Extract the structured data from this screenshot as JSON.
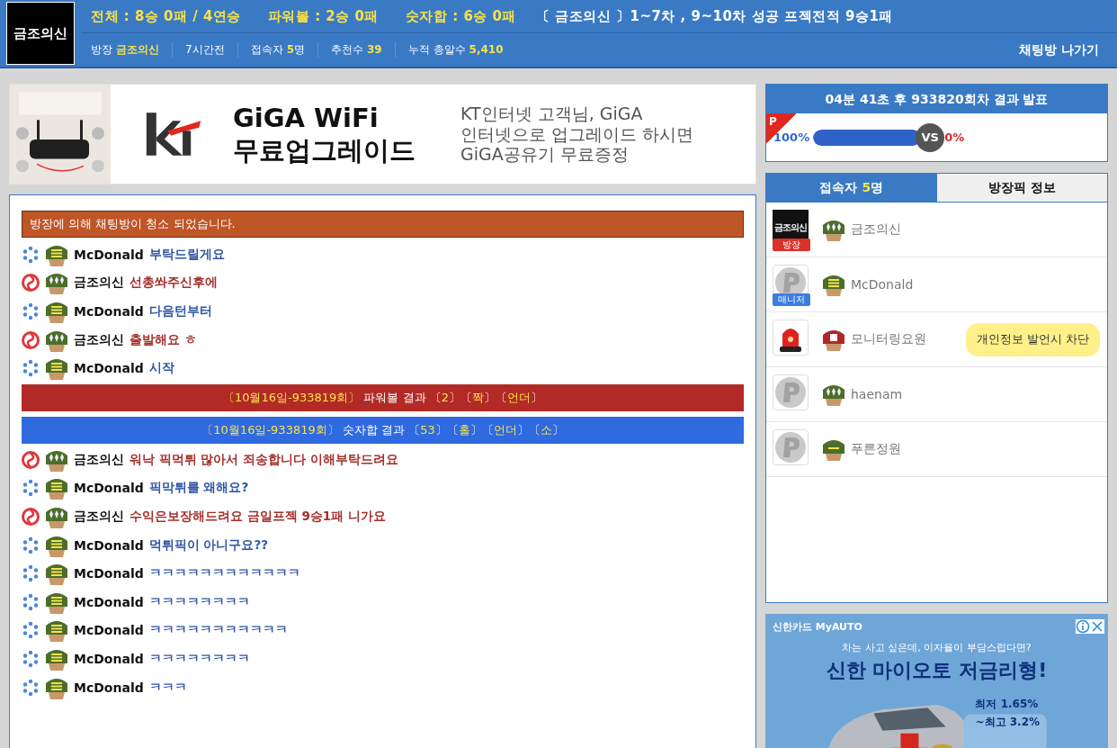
{
  "header": {
    "logo": "금조의신",
    "records": [
      {
        "text": "전체 : 8승 0패 / 4연승",
        "highlight": true
      },
      {
        "text": "파워볼 : 2승 0패",
        "highlight": true
      },
      {
        "text": "숫자합 : 6승 0패",
        "highlight": true
      },
      {
        "text": "〔 금조의신 〕1~7차 , 9~10차 성공 프젝전적 9승1패",
        "highlight": false
      }
    ],
    "info": [
      {
        "label": "방장",
        "value": "금조의신"
      },
      {
        "label": "7시간전"
      },
      {
        "label": "접속자",
        "value": "5",
        "suffix": "명"
      },
      {
        "label": "추천수",
        "value": "39"
      },
      {
        "label": "누적 총알수",
        "value": "5,410"
      }
    ],
    "exit_button": "채팅방 나가기"
  },
  "banner_ad": {
    "title_lines": [
      "GiGA WiFi",
      "무료업그레이드"
    ],
    "body_lines": [
      "KT인터넷 고객님, GiGA",
      "인터넷으로 업그레이드 하시면",
      "GiGA공유기 무료증정"
    ]
  },
  "chat": [
    {
      "kind": "notice",
      "text": "방장에 의해 채팅방이 청소 되었습니다."
    },
    {
      "kind": "message",
      "badge": {
        "kind": "dots"
      },
      "cap": {
        "kind": "bars"
      },
      "name": "McDonald",
      "text": "부탁드릴게요",
      "color": "#2f55a4"
    },
    {
      "kind": "message",
      "badge": {
        "kind": "swirl"
      },
      "cap": {
        "kind": "diamonds"
      },
      "name": "금조의신",
      "text": "선총쏴주신후에",
      "color": "#a3302c"
    },
    {
      "kind": "message",
      "badge": {
        "kind": "dots"
      },
      "cap": {
        "kind": "bars"
      },
      "name": "McDonald",
      "text": "다음턴부터",
      "color": "#2f55a4"
    },
    {
      "kind": "message",
      "badge": {
        "kind": "swirl"
      },
      "cap": {
        "kind": "diamonds"
      },
      "name": "금조의신",
      "text": "출발해요 ㅎ",
      "color": "#a3302c"
    },
    {
      "kind": "message",
      "badge": {
        "kind": "dots"
      },
      "cap": {
        "kind": "bars"
      },
      "name": "McDonald",
      "text": "시작",
      "color": "#2f55a4"
    },
    {
      "kind": "result",
      "color": "#b22a26",
      "parts": [
        {
          "text": "〔10월16일-933819회〕",
          "highlight": true
        },
        {
          "text": " 파워볼 결과 〔",
          "highlight": false
        },
        {
          "text": "2",
          "highlight": true
        },
        {
          "text": "〕〔",
          "highlight": false
        },
        {
          "text": "짝",
          "highlight": true
        },
        {
          "text": "〕〔",
          "highlight": false
        },
        {
          "text": "언더",
          "highlight": true
        },
        {
          "text": "〕",
          "highlight": false
        }
      ]
    },
    {
      "kind": "result",
      "color": "#2f6ae0",
      "parts": [
        {
          "text": "〔10월16일-933819회〕",
          "highlight": true
        },
        {
          "text": " 숫자합 결과 〔",
          "highlight": false
        },
        {
          "text": "53",
          "highlight": true
        },
        {
          "text": "〕〔",
          "highlight": false
        },
        {
          "text": "홀",
          "highlight": true
        },
        {
          "text": "〕〔",
          "highlight": false
        },
        {
          "text": "언더",
          "highlight": true
        },
        {
          "text": "〕〔",
          "highlight": false
        },
        {
          "text": "소",
          "highlight": true
        },
        {
          "text": "〕",
          "highlight": false
        }
      ]
    },
    {
      "kind": "message",
      "badge": {
        "kind": "swirl"
      },
      "cap": {
        "kind": "diamonds"
      },
      "name": "금조의신",
      "text": "워낙 픽먹튀 많아서 죄송합니다 이해부탁드려요",
      "color": "#a3302c"
    },
    {
      "kind": "message",
      "badge": {
        "kind": "dots"
      },
      "cap": {
        "kind": "bars"
      },
      "name": "McDonald",
      "text": "픽막튀를 왜해요?",
      "color": "#2f55a4"
    },
    {
      "kind": "message",
      "badge": {
        "kind": "swirl"
      },
      "cap": {
        "kind": "diamonds"
      },
      "name": "금조의신",
      "text": "수익은보장해드려요 금일프젝 9승1패 니가요",
      "color": "#a3302c"
    },
    {
      "kind": "message",
      "badge": {
        "kind": "dots"
      },
      "cap": {
        "kind": "bars"
      },
      "name": "McDonald",
      "text": "먹튀픽이 아니구요??",
      "color": "#2f55a4"
    },
    {
      "kind": "message",
      "badge": {
        "kind": "dots"
      },
      "cap": {
        "kind": "bars"
      },
      "name": "McDonald",
      "text": "ㅋㅋㅋㅋㅋㅋㅋㅋㅋㅋㅋㅋ",
      "color": "#2f55a4"
    },
    {
      "kind": "message",
      "badge": {
        "kind": "dots"
      },
      "cap": {
        "kind": "bars"
      },
      "name": "McDonald",
      "text": "ㅋㅋㅋㅋㅋㅋㅋㅋ",
      "color": "#2f55a4"
    },
    {
      "kind": "message",
      "badge": {
        "kind": "dots"
      },
      "cap": {
        "kind": "bars"
      },
      "name": "McDonald",
      "text": "ㅋㅋㅋㅋㅋㅋㅋㅋㅋㅋㅋ",
      "color": "#2f55a4"
    },
    {
      "kind": "message",
      "badge": {
        "kind": "dots"
      },
      "cap": {
        "kind": "bars"
      },
      "name": "McDonald",
      "text": "ㅋㅋㅋㅋㅋㅋㅋㅋ",
      "color": "#2f55a4"
    },
    {
      "kind": "message",
      "badge": {
        "kind": "dots"
      },
      "cap": {
        "kind": "bars"
      },
      "name": "McDonald",
      "text": "ㅋㅋㅋ",
      "color": "#2f55a4"
    }
  ],
  "countdown": {
    "title": "04분 41초 후 933820회차 결과 발표",
    "corner": "P",
    "left_percent": "100%",
    "right_percent": "0%",
    "vs": "VS",
    "level": 1
  },
  "tabs": [
    {
      "label": "접속자",
      "count": "5",
      "suffix": "명",
      "selected": true
    },
    {
      "label": "방장픽 정보",
      "selected": false
    }
  ],
  "users": [
    {
      "avatar": {
        "kind": "logo",
        "text": "금조의신"
      },
      "role": {
        "text": "방장",
        "color": "#d9322b"
      },
      "cap": {
        "kind": "diamonds"
      },
      "name": "금조의신"
    },
    {
      "avatar": {
        "kind": "p"
      },
      "role": {
        "text": "매니저",
        "color": "#3b7de0"
      },
      "cap": {
        "kind": "bars"
      },
      "name": "McDonald"
    },
    {
      "avatar": {
        "kind": "siren"
      },
      "cap": {
        "kind": "square"
      },
      "name": "모니터링요원",
      "note": "개인정보 발언시 차단"
    },
    {
      "avatar": {
        "kind": "p"
      },
      "cap": {
        "kind": "diamonds"
      },
      "name": "haenam"
    },
    {
      "avatar": {
        "kind": "p"
      },
      "cap": {
        "kind": "line"
      },
      "name": "푸른정원"
    }
  ],
  "side_ad": {
    "brand": "신한카드 MyAUTO",
    "question": "차는 사고 싶은데, 이자율이 부담스럽다면?",
    "headline": "신한 마이오토 저금리형!",
    "rates": [
      "최저 1.65%",
      "~최고 3.2%"
    ]
  }
}
